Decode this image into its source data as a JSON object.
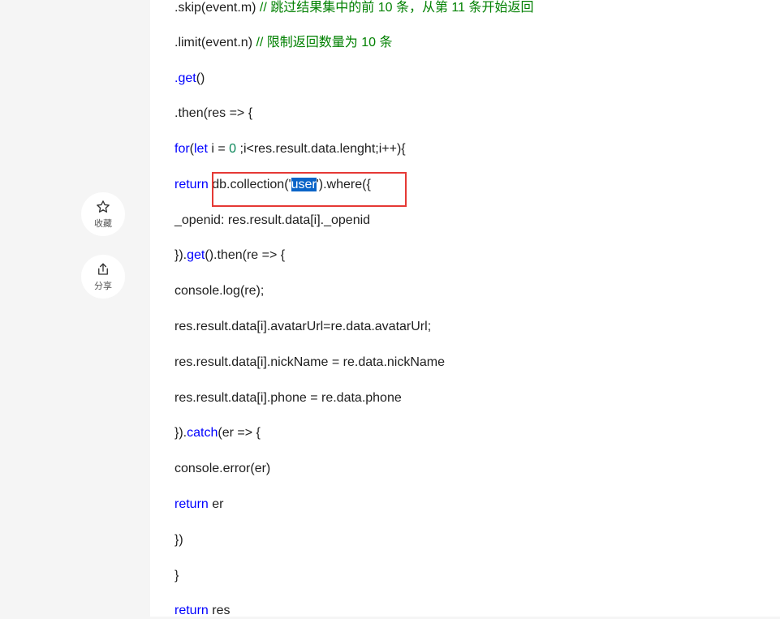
{
  "sidebar": {
    "favorite_label": "收藏",
    "share_label": "分享"
  },
  "code": {
    "l1": {
      "a": ".skip(event.m) ",
      "comment": "// 跳过结果集中的前 10 条，从第 11 条开始返回"
    },
    "l2": {
      "a": ".limit(event.n) ",
      "comment": "// 限制返回数量为 10 条"
    },
    "l3": {
      "kw": ".get",
      "a": "()"
    },
    "l4": {
      "a": ".then(res => {"
    },
    "l5": {
      "kw1": "for",
      "a": "(",
      "kw2": "let",
      "b": " i = ",
      "num": "0",
      "c": " ;i<res.result.data.lenght;i++){"
    },
    "l6": {
      "kw": "return",
      "a": " db.collection('",
      "sel": "user",
      "b": "').where({"
    },
    "l7": {
      "a": "_openid: res.result.data[i]._openid"
    },
    "l8": {
      "a": "}).",
      "kw": "get",
      "b": "().then(re => {"
    },
    "l9": {
      "a": "console.log(re);"
    },
    "l10": {
      "a": "res.result.data[i].avatarUrl=re.data.avatarUrl;"
    },
    "l11": {
      "a": "res.result.data[i].nickName = re.data.nickName"
    },
    "l12": {
      "a": "res.result.data[i].phone = re.data.phone"
    },
    "l13": {
      "a": "}).",
      "kw": "catch",
      "b": "(er => {"
    },
    "l14": {
      "a": "console.error(er)"
    },
    "l15": {
      "kw": "return",
      "a": " er"
    },
    "l16": {
      "a": "})"
    },
    "l17": {
      "a": "}"
    },
    "l18": {
      "kw": "return",
      "a": " res"
    }
  },
  "colors": {
    "keyword": "#0000ff",
    "number": "#098658",
    "comment": "#008000",
    "highlight_border": "#e53935",
    "selection": "#0a64c8"
  }
}
